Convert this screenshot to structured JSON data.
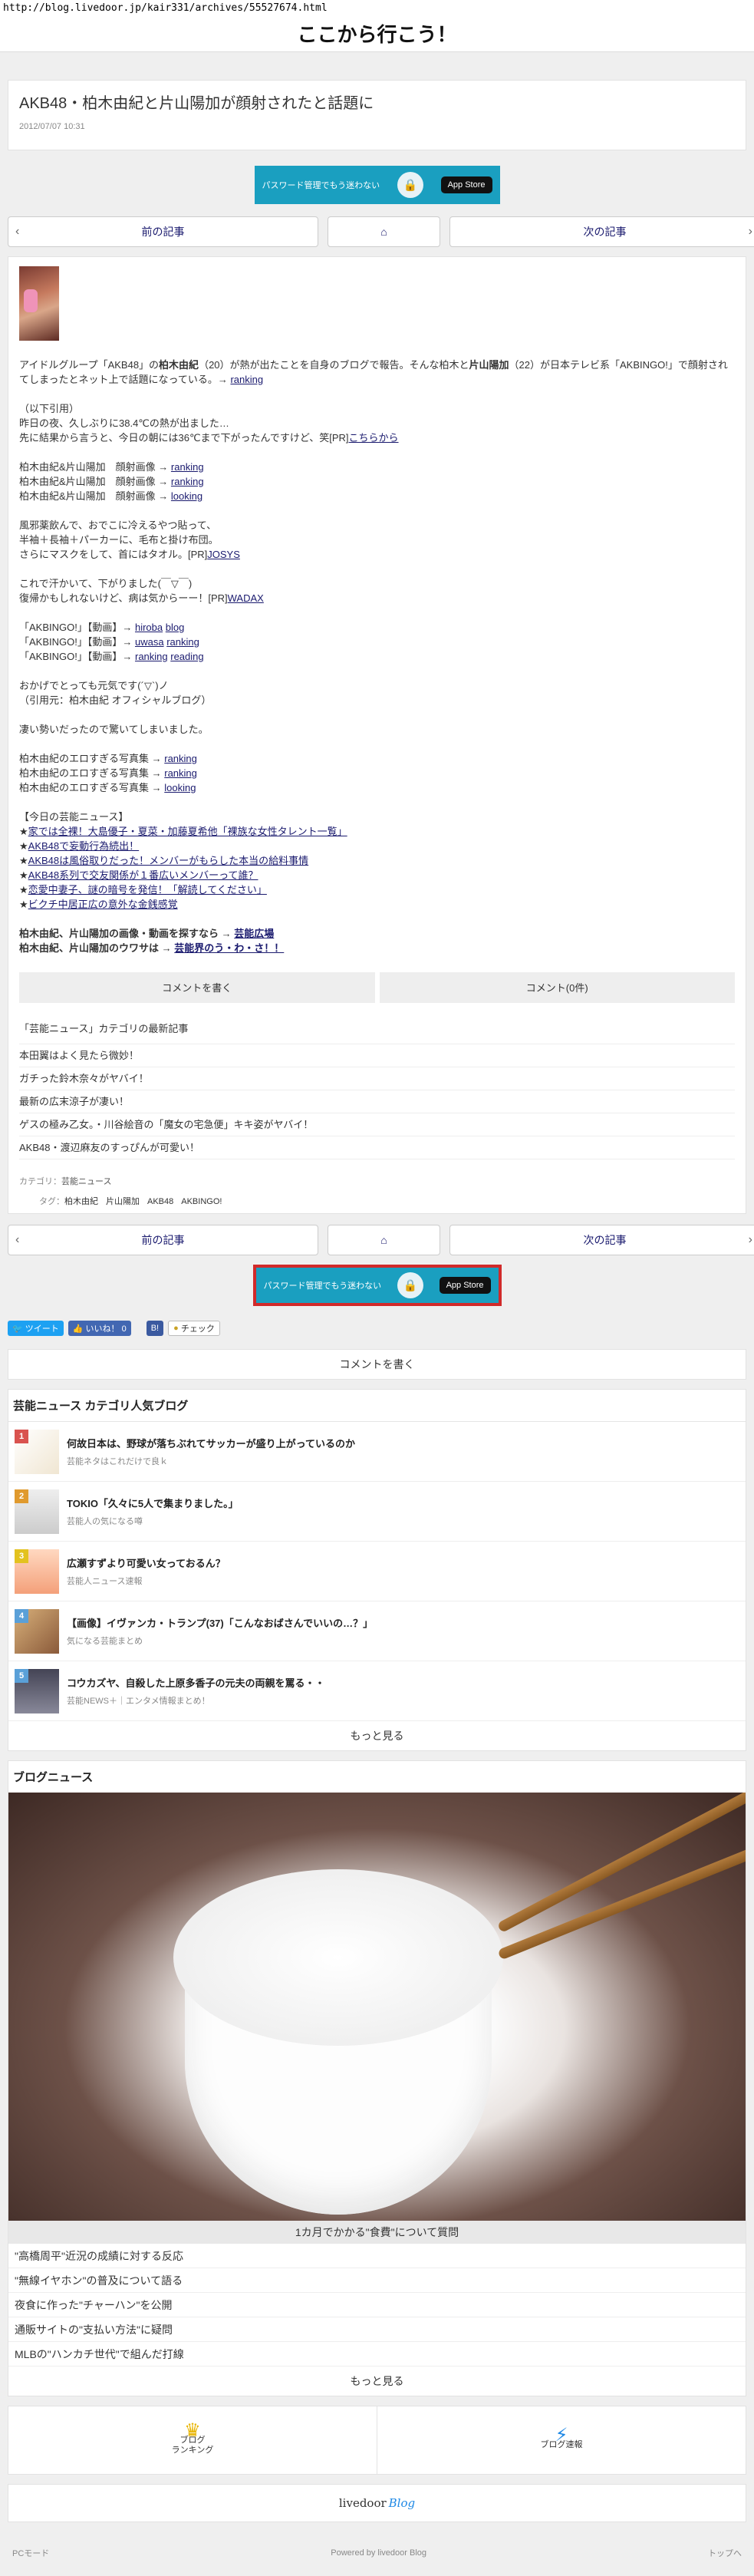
{
  "browser": {
    "url": "http://blog.livedoor.jp/kair331/archives/55527674.html"
  },
  "blog": {
    "title": "ここから行こう！"
  },
  "entry": {
    "title": "AKB48・柏木由紀と片山陽加が顔射されたと話題に",
    "date": "2012/07/07 10:31",
    "intro1": "アイドルグループ「AKB48」の",
    "intro_kashiwagi": "柏木由紀",
    "intro2": "（20）が熱が出たことを自身のブログで報告。そんな柏木と",
    "intro_katayama": "片山陽加",
    "intro3": "（22）が日本テレビ系「AKBINGO!」で顔射されてしまったとネット上で話題になっている。→",
    "ranking": "ranking",
    "quote_head": "（以下引用）",
    "quote1": "昨日の夜、久しぶりに38.4℃の熱が出ました…",
    "quote2a": "先に結果から言うと、今日の朝には36℃まで下がったんですけど、笑[PR]",
    "quote2link": "こちらから",
    "g1": [
      {
        "t": "柏木由紀&片山陽加　顔射画像 →",
        "l": "ranking"
      },
      {
        "t": "柏木由紀&片山陽加　顔射画像 →",
        "l": "ranking"
      },
      {
        "t": "柏木由紀&片山陽加　顔射画像 →",
        "l": "looking"
      }
    ],
    "p1": "風邪薬飲んで、おでこに冷えるやつ貼って、",
    "p2": "半袖＋長袖＋パーカーに、毛布と掛け布団。",
    "p3a": "さらにマスクをして、首にはタオル。[PR]",
    "p3link": "JOSYS",
    "p4": "これで汗かいて、下がりました(￣▽￣)",
    "p5a": "復帰かもしれないけど、病は気からーー！[PR]",
    "p5link": "WADAX",
    "g2": [
      {
        "t": "「AKBINGO!」【動画】→",
        "l1": "hiroba",
        "l2": "blog"
      },
      {
        "t": "「AKBINGO!」【動画】→",
        "l1": "uwasa",
        "l2": "ranking"
      },
      {
        "t": "「AKBINGO!」【動画】→",
        "l1": "ranking",
        "l2": "reading"
      }
    ],
    "p6": "おかげでとっても元気です(´▽`)ノ",
    "p7": "（引用元：柏木由紀 オフィシャルブログ）",
    "p8": "凄い勢いだったので驚いてしまいました。",
    "g3": [
      {
        "t": "柏木由紀のエロすぎる写真集 →",
        "l": "ranking"
      },
      {
        "t": "柏木由紀のエロすぎる写真集 →",
        "l": "ranking"
      },
      {
        "t": "柏木由紀のエロすぎる写真集 →",
        "l": "looking"
      }
    ],
    "news_head": "【今日の芸能ニュース】",
    "news": [
      "家では全裸！大島優子・夏菜・加藤夏希他「裸族な女性タレント一覧」",
      "AKB48で妄動行為続出！",
      "AKB48は風俗取りだった！メンバーがもらした本当の給料事情",
      "AKB48系列で交友関係が１番広いメンバーって誰？",
      "恋愛中妻子、謎の暗号を発信！「解読してください」",
      "ビクチ中居正広の意外な金銭感覚"
    ],
    "end1a": "柏木由紀、片山陽加の画像・動画を探すなら →",
    "end1link": "芸能広場",
    "end2a": "柏木由紀、片山陽加のウワサは →",
    "end2link": "芸能界のう・わ・さ！！"
  },
  "comments": {
    "write": "コメントを書く",
    "count": "コメント(0件)"
  },
  "category_latest": {
    "title": "「芸能ニュース」カテゴリの最新記事",
    "items": [
      "本田翼はよく見たら微妙！",
      "ガチった鈴木奈々がヤバイ！",
      "最新の広末涼子が凄い！",
      "ゲスの極み乙女。・川谷絵音の「魔女の宅急便」キキ姿がヤバイ！",
      "AKB48・渡辺麻友のすっぴんが可愛い！"
    ]
  },
  "meta": {
    "category_label": "カテゴリ：",
    "category": "芸能ニュース",
    "tag_label": "タグ：",
    "tags": [
      "柏木由紀",
      "片山陽加",
      "AKB48",
      "AKBINGO!"
    ]
  },
  "pager": {
    "prev": "前の記事",
    "next": "次の記事"
  },
  "ad": {
    "text": "パスワード管理でもう迷わない",
    "store": " App Store"
  },
  "social": {
    "tweet": "ツイート",
    "like": "いいね！ 0",
    "check": "チェック"
  },
  "write_comment": "コメントを書く",
  "popular": {
    "title": "芸能ニュース カテゴリ人気ブログ",
    "items": [
      {
        "rank": "1",
        "title": "何故日本は、野球が落ちぶれてサッカーが盛り上がっているのか",
        "source": "芸能ネタはこれだけで良ｋ",
        "color": "#d9534f"
      },
      {
        "rank": "2",
        "title": "TOKIO「久々に5人で集まりました。」",
        "source": "芸能人の気になる噂",
        "color": "#e09a2e"
      },
      {
        "rank": "3",
        "title": "広瀬すずより可愛い女っておるん？",
        "source": "芸能人ニュース速報",
        "color": "#e3c21f"
      },
      {
        "rank": "4",
        "title": "【画像】イヴァンカ・トランプ(37)「こんなおばさんでいいの…？」",
        "source": "気になる芸能まとめ",
        "color": "#5aa0d8"
      },
      {
        "rank": "5",
        "title": "コウカズヤ、自殺した上原多香子の元夫の両親を罵る・・",
        "source": "芸能NEWS＋｜エンタメ情報まとめ！",
        "color": "#5aa0d8"
      }
    ],
    "more": "もっと見る"
  },
  "blog_news": {
    "title": "ブログニュース",
    "caption": "1カ月でかかる\"食費\"について質問",
    "items": [
      "\"高橋周平\"近況の成績に対する反応",
      "\"無線イヤホン\"の普及について語る",
      "夜食に作った\"チャーハン\"を公開",
      "通販サイトの\"支払い方法\"に疑問",
      "MLBの\"ハンカチ世代\"で組んだ打線"
    ],
    "more": "もっと見る"
  },
  "footer_nav": {
    "ranking_l1": "ブログ",
    "ranking_l2": "ランキング",
    "news": "ブログ速報"
  },
  "logo": {
    "brand": "livedoor",
    "blog": "Blog"
  },
  "bottom": {
    "pc": "PCモード",
    "powered": "Powered by livedoor Blog",
    "top": "トップへ"
  }
}
